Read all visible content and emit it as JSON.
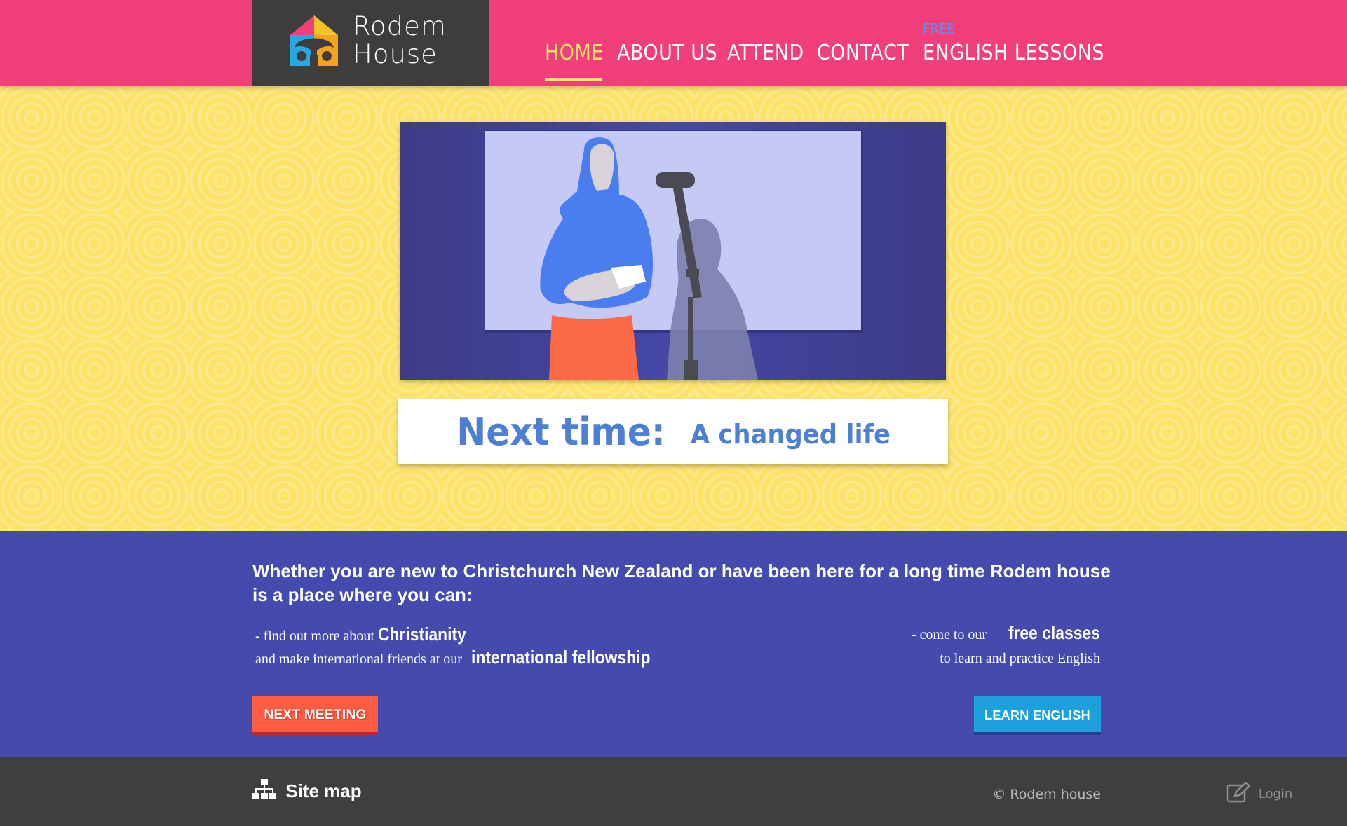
{
  "brand": {
    "name_line1": "Rodem",
    "name_line2": "House",
    "colors": {
      "header": "#f13f7b",
      "logo_bg": "#3f3c3e",
      "hero": "#fde36a",
      "band": "#454aae",
      "footer": "#403e41",
      "accent": "#ffe26d"
    }
  },
  "nav": {
    "items": [
      {
        "label": "HOME",
        "active": true
      },
      {
        "label": "ABOUT US",
        "active": false
      },
      {
        "label": "ATTEND",
        "active": false
      },
      {
        "label": "CONTACT",
        "active": false
      },
      {
        "label": "ENGLISH LESSONS",
        "active": false,
        "tag": "FREE"
      }
    ]
  },
  "hero": {
    "image_desc_icon": "woman-speaking-at-microphone-illustration",
    "next_prefix": "Next time:",
    "next_title": "A changed life"
  },
  "band": {
    "intro": "Whether you are new to Christchurch New Zealand or have been here for a long time Rodem house is a place where you can:",
    "left": {
      "line1_prefix": "- find out more about",
      "line1_highlight": "Christianity",
      "line2_prefix": "and make international friends at our",
      "line2_highlight": "international fellowship"
    },
    "right": {
      "line1_prefix": "- come to our",
      "line1_highlight": "free classes",
      "line2": "to learn and practice English"
    },
    "buttons": {
      "next_meeting": "NEXT MEETING",
      "learn_english": "LEARN ENGLISH"
    }
  },
  "footer": {
    "sitemap": "Site map",
    "copyright": "© Rodem house",
    "login": "Login"
  }
}
